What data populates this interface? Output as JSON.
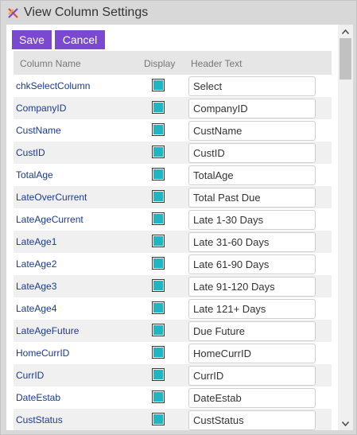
{
  "window": {
    "title": "View Column Settings",
    "icon": "app-logo-icon"
  },
  "toolbar": {
    "save_label": "Save",
    "cancel_label": "Cancel"
  },
  "table": {
    "headers": {
      "column_name": "Column Name",
      "display": "Display",
      "header_text": "Header Text"
    },
    "rows": [
      {
        "name": "chkSelectColumn",
        "display": true,
        "header": "Select"
      },
      {
        "name": "CompanyID",
        "display": true,
        "header": "CompanyID"
      },
      {
        "name": "CustName",
        "display": true,
        "header": "CustName"
      },
      {
        "name": "CustID",
        "display": true,
        "header": "CustID"
      },
      {
        "name": "TotalAge",
        "display": true,
        "header": "TotalAge"
      },
      {
        "name": "LateOverCurrent",
        "display": true,
        "header": "Total Past Due"
      },
      {
        "name": "LateAgeCurrent",
        "display": true,
        "header": "Late 1-30 Days"
      },
      {
        "name": "LateAge1",
        "display": true,
        "header": "Late 31-60 Days"
      },
      {
        "name": "LateAge2",
        "display": true,
        "header": "Late 61-90 Days"
      },
      {
        "name": "LateAge3",
        "display": true,
        "header": "Late 91-120 Days"
      },
      {
        "name": "LateAge4",
        "display": true,
        "header": "Late 121+ Days"
      },
      {
        "name": "LateAgeFuture",
        "display": true,
        "header": "Due Future"
      },
      {
        "name": "HomeCurrID",
        "display": true,
        "header": "HomeCurrID"
      },
      {
        "name": "CurrID",
        "display": true,
        "header": "CurrID"
      },
      {
        "name": "DateEstab",
        "display": true,
        "header": "DateEstab"
      },
      {
        "name": "CustStatus",
        "display": true,
        "header": "CustStatus"
      }
    ]
  },
  "colors": {
    "button_bg": "#7b48d1",
    "checkbox_fill": "#1fb6c4",
    "row_alt": "#f0f0f0",
    "header_bg": "#e6e6e6"
  }
}
